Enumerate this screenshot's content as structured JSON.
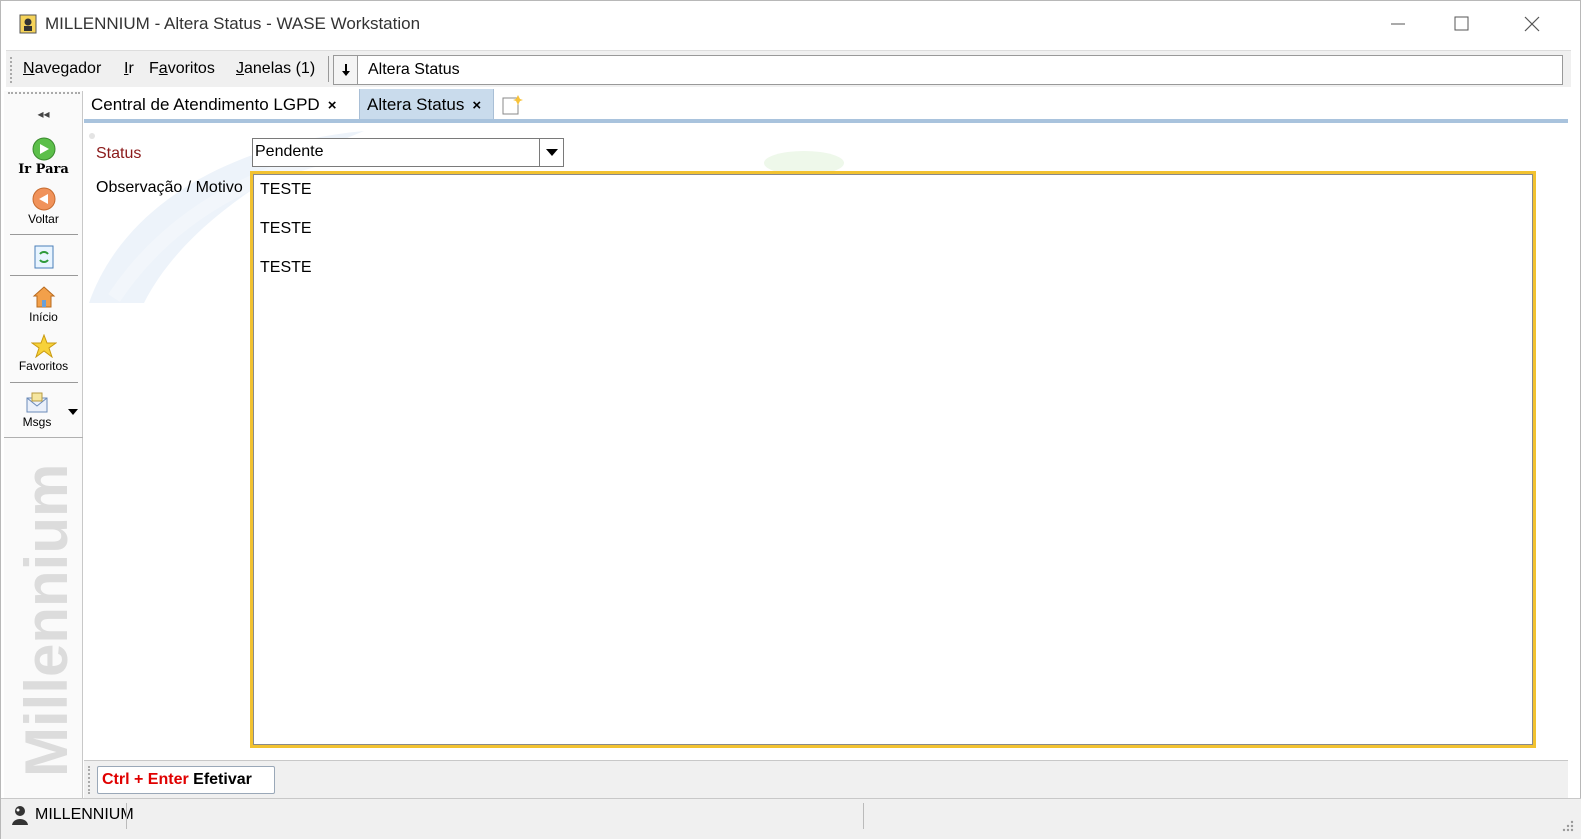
{
  "window": {
    "title": "MILLENNIUM - Altera Status - WASE Workstation"
  },
  "menu": {
    "items": [
      {
        "label_u": "N",
        "label_rest": "avegador"
      },
      {
        "label_u": "I",
        "label_rest": "r"
      },
      {
        "label_pre": "F",
        "label_u": "a",
        "label_rest": "voritos"
      },
      {
        "label_u": "J",
        "label_rest": "anelas (1)"
      }
    ],
    "goto_value": "Altera Status"
  },
  "leftnav": {
    "collapse": "◂◂",
    "items": [
      {
        "label": "Ir Para",
        "icon": "go-arrow-icon"
      },
      {
        "label": "Voltar",
        "icon": "back-arrow-icon"
      },
      {
        "label": "",
        "icon": "refresh-icon"
      },
      {
        "label": "Início",
        "icon": "home-icon"
      },
      {
        "label": "Favoritos",
        "icon": "star-icon"
      },
      {
        "label": "Msgs",
        "icon": "mail-icon"
      }
    ],
    "brand": "Millennium"
  },
  "tabs": [
    {
      "label": "Central de Atendimento LGPD",
      "close": "×"
    },
    {
      "label": "Altera Status",
      "close": "×",
      "active": true
    }
  ],
  "form": {
    "status_label": "Status",
    "status_value": "Pendente",
    "obs_label": "Observação / Motivo",
    "obs_lines": [
      "TESTE",
      "TESTE",
      "TESTE"
    ]
  },
  "actions": {
    "efetivar_key": "Ctrl + Enter",
    "efetivar_label": "Efetivar"
  },
  "statusbar": {
    "text": "MILLENNIUM"
  },
  "colors": {
    "accent_tab": "#c9dbec",
    "focus_border": "#f2c230",
    "required_label": "#8b1a1a",
    "shortcut_red": "#e00000"
  }
}
